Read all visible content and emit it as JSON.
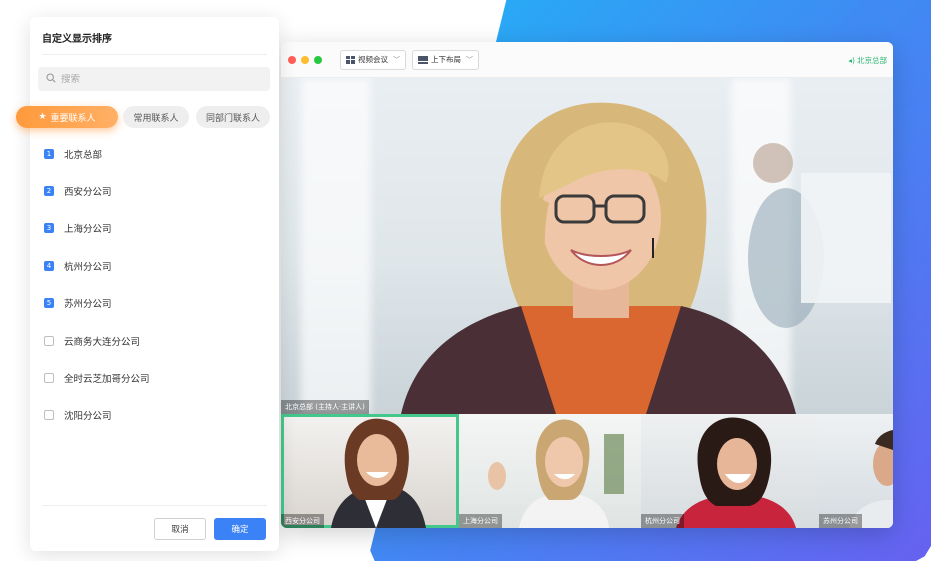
{
  "panel": {
    "title": "自定义显示排序",
    "search_placeholder": "搜索",
    "tabs": [
      "重要联系人",
      "常用联系人",
      "同部门联系人"
    ],
    "ranked_items": [
      {
        "num": "1",
        "label": "北京总部"
      },
      {
        "num": "2",
        "label": "西安分公司"
      },
      {
        "num": "3",
        "label": "上海分公司"
      },
      {
        "num": "4",
        "label": "杭州分公司"
      },
      {
        "num": "5",
        "label": "苏州分公司"
      }
    ],
    "unchecked_items": [
      "云商务大连分公司",
      "全时云芝加哥分公司",
      "沈阳分公司"
    ],
    "cancel_label": "取消",
    "ok_label": "确定"
  },
  "meeting": {
    "view_mode": "视频会议",
    "layout_mode": "上下布局",
    "current_location": "北京总部",
    "main_caption": "北京总部 (主持人·主讲人)",
    "thumbnails": [
      "西安分公司",
      "上海分公司",
      "杭州分公司",
      "苏州分公司"
    ]
  },
  "colors": {
    "accent_blue": "#3b82f6",
    "tab_orange": "#ff9a3c",
    "active_green": "#44c78b",
    "mac_red": "#ff5f57",
    "mac_yellow": "#febc2e",
    "mac_green": "#28c840"
  }
}
